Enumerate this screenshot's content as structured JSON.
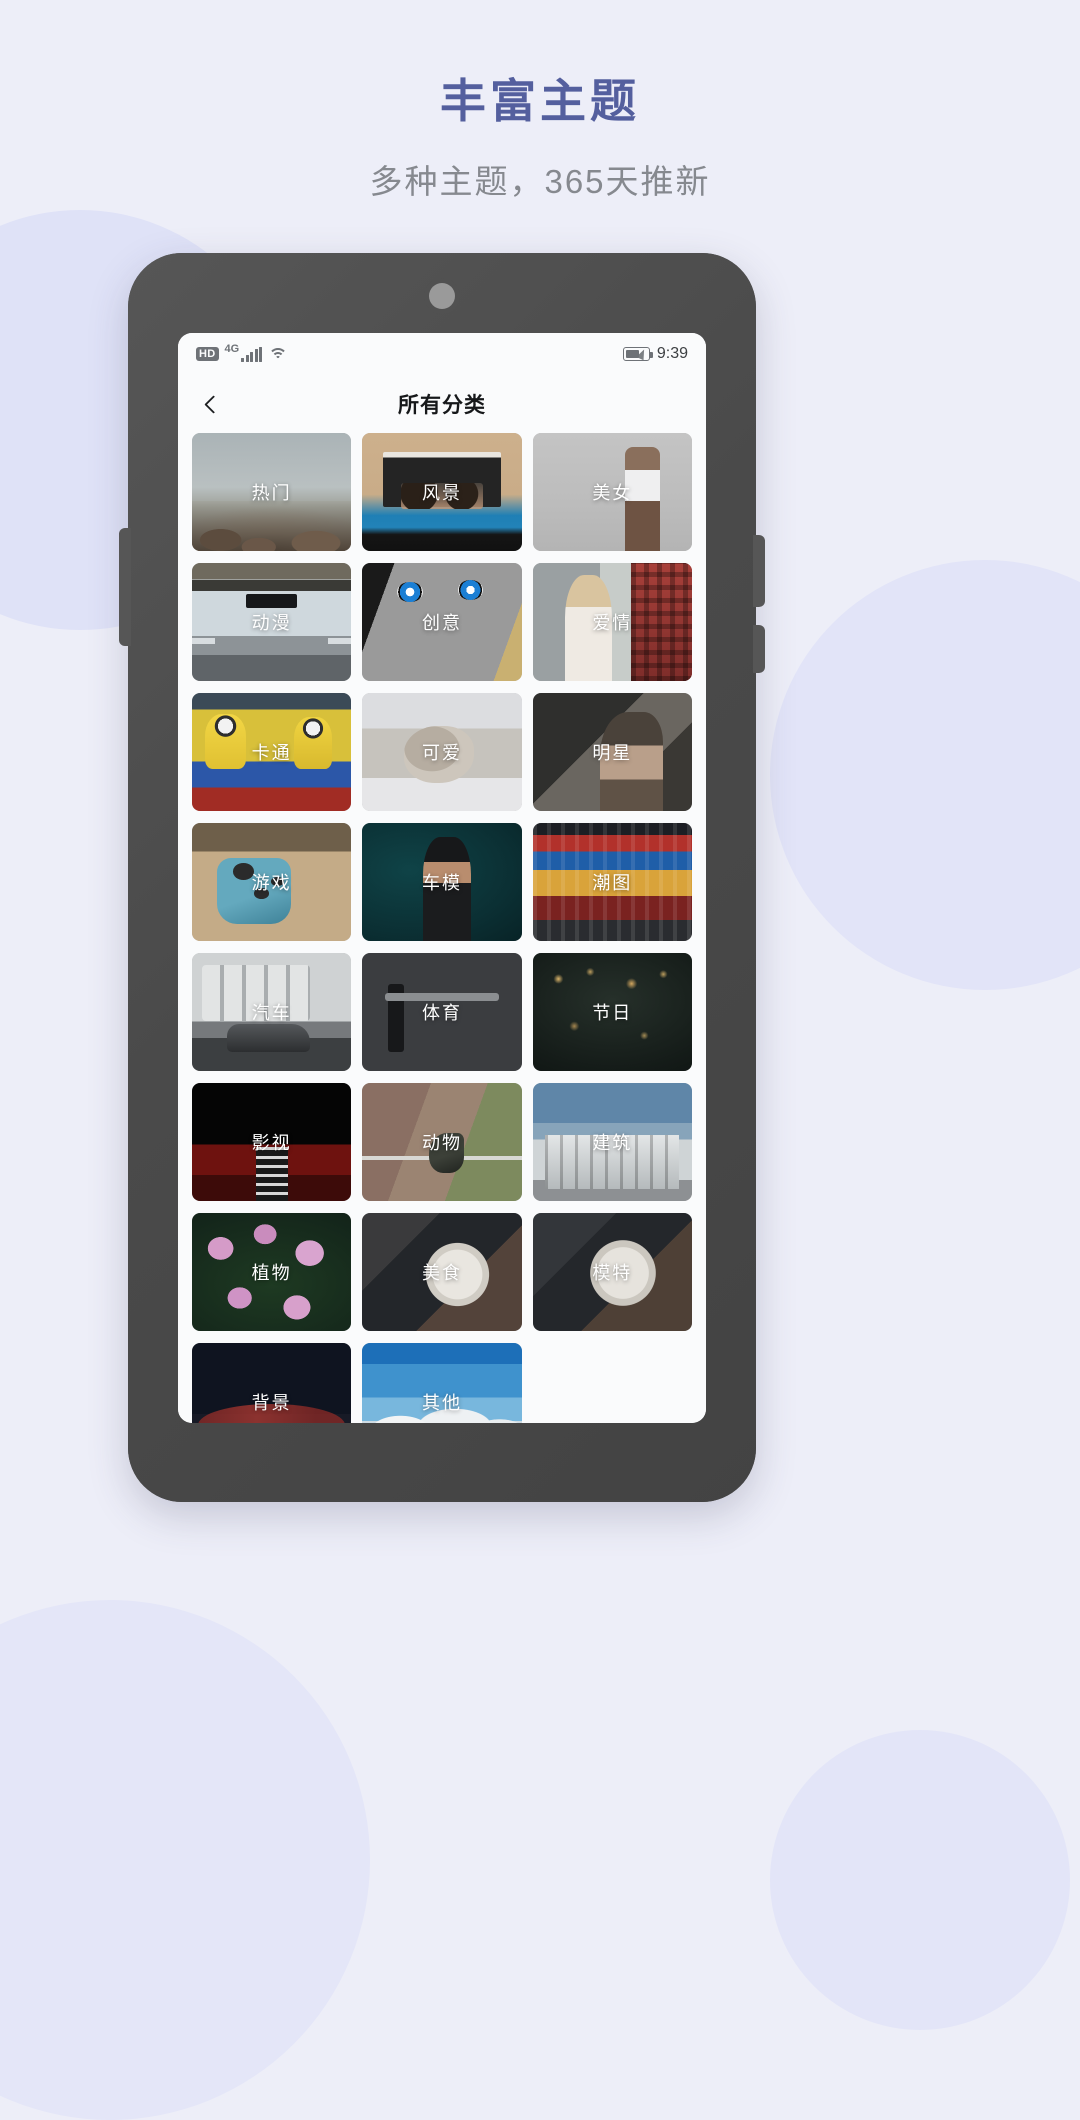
{
  "promo": {
    "title": "丰富主题",
    "subtitle": "多种主题，365天推新",
    "title_color": "#545f9e",
    "subtitle_color": "#86898f",
    "background_color": "#edeef8"
  },
  "status_bar": {
    "hd_label": "HD",
    "network_label": "4G",
    "signal_icon": "signal-bars-icon",
    "wifi_icon": "wifi-icon",
    "battery_icon": "battery-charging-icon",
    "time": "9:39"
  },
  "app_bar": {
    "back_icon": "chevron-left-icon",
    "title": "所有分类"
  },
  "grid": {
    "categories": [
      {
        "label": "热门",
        "art": "a-hot"
      },
      {
        "label": "风景",
        "art": "a-view"
      },
      {
        "label": "美女",
        "art": "a-girl"
      },
      {
        "label": "动漫",
        "art": "a-anime"
      },
      {
        "label": "创意",
        "art": "a-create"
      },
      {
        "label": "爱情",
        "art": "a-love"
      },
      {
        "label": "卡通",
        "art": "a-cartoon"
      },
      {
        "label": "可爱",
        "art": "a-cute"
      },
      {
        "label": "明星",
        "art": "a-star"
      },
      {
        "label": "游戏",
        "art": "a-game"
      },
      {
        "label": "车模",
        "art": "a-model"
      },
      {
        "label": "潮图",
        "art": "a-trend"
      },
      {
        "label": "汽车",
        "art": "a-car"
      },
      {
        "label": "体育",
        "art": "a-sport"
      },
      {
        "label": "节日",
        "art": "a-fest"
      },
      {
        "label": "影视",
        "art": "a-movie"
      },
      {
        "label": "动物",
        "art": "a-animal"
      },
      {
        "label": "建筑",
        "art": "a-arch"
      },
      {
        "label": "植物",
        "art": "a-plant"
      },
      {
        "label": "美食",
        "art": "a-food"
      },
      {
        "label": "模特",
        "art": "a-modelf"
      },
      {
        "label": "背景",
        "art": "a-bg"
      },
      {
        "label": "其他",
        "art": "a-other"
      }
    ]
  }
}
